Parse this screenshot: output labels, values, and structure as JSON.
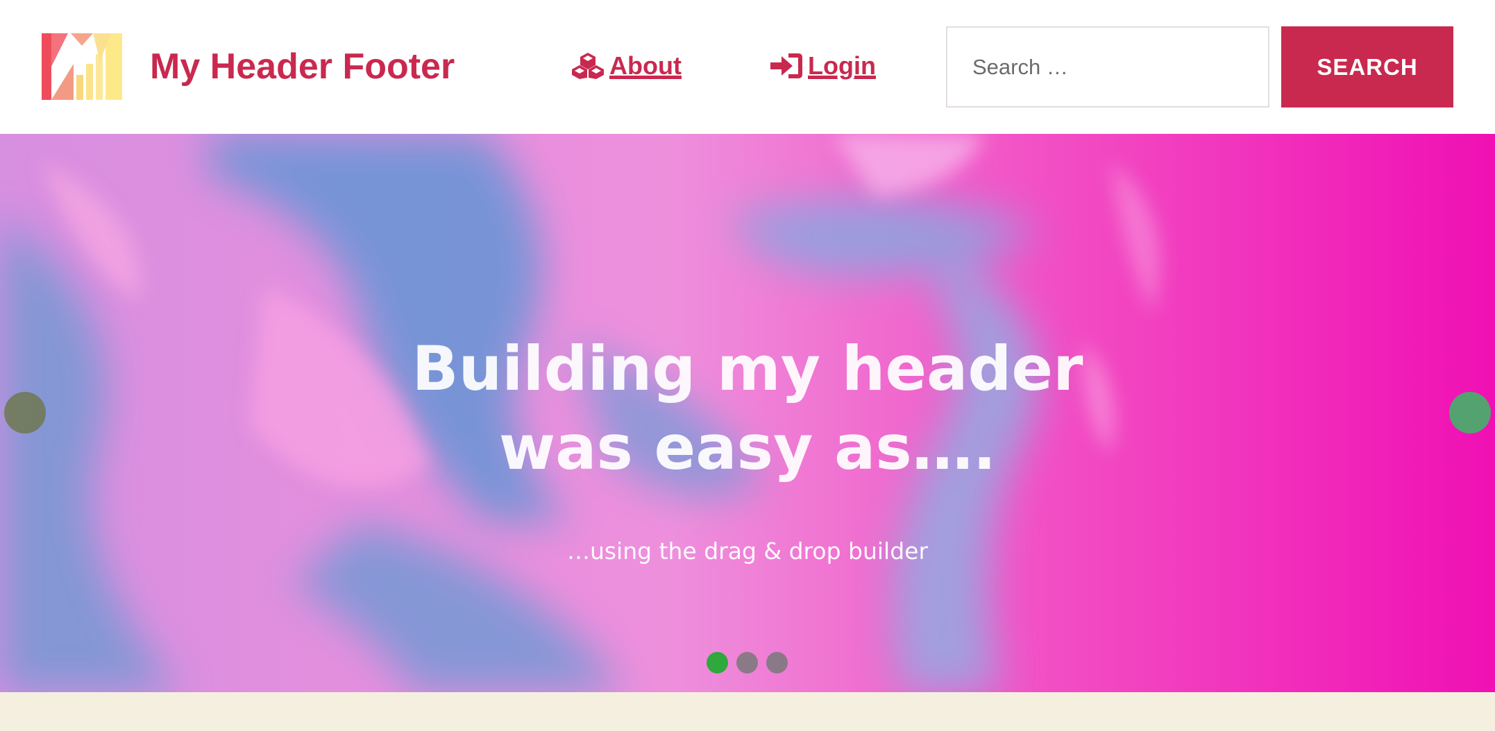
{
  "header": {
    "site_title": "My Header Footer",
    "logo_icon": "stylized-m-logo-icon",
    "nav": [
      {
        "label": "About",
        "icon": "cubes-icon"
      },
      {
        "label": "Login",
        "icon": "sign-in-icon"
      }
    ],
    "search": {
      "placeholder": "Search …",
      "button_label": "SEARCH"
    }
  },
  "hero": {
    "heading_line1": "Building my header",
    "heading_line2": "was easy as….",
    "subheading": "…using the drag & drop builder",
    "slides_count": 3,
    "active_slide": 1
  },
  "colors": {
    "brand": "#c9294f",
    "header_bg": "#ffffff",
    "page_bg": "#f5efe0",
    "dot_active": "#2fa83c",
    "arrow_next": "#46af69"
  }
}
